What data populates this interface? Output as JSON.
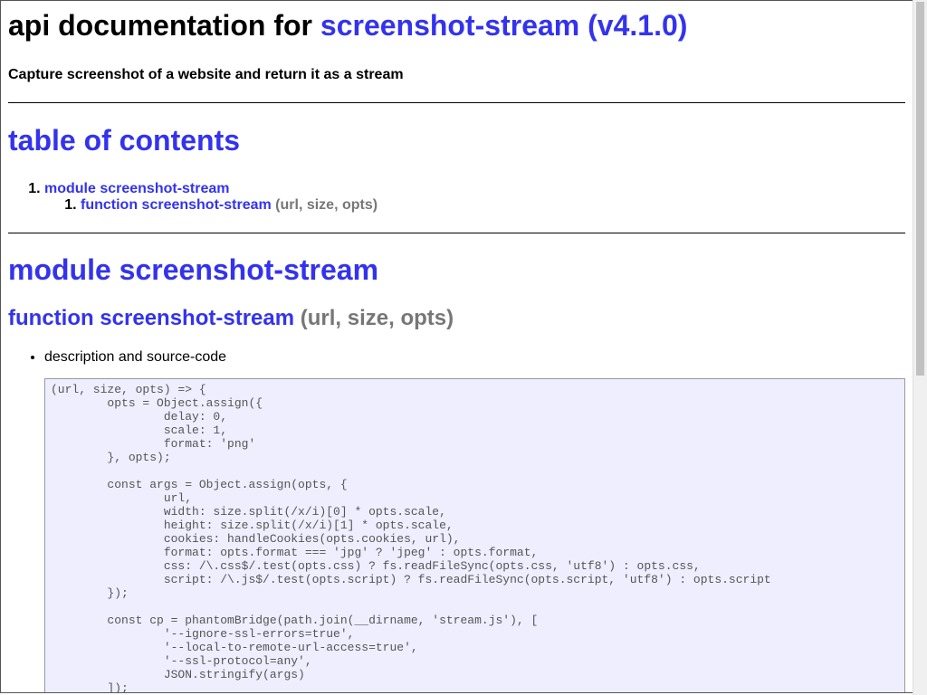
{
  "header": {
    "title_prefix": "api documentation for",
    "package_link": "screenshot-stream (v4.1.0)",
    "description": "Capture screenshot of a website and return it as a stream"
  },
  "toc": {
    "heading": "table of contents",
    "items": [
      {
        "number": "1.",
        "label": "module screenshot-stream",
        "children": [
          {
            "number": "1.",
            "label": "function screenshot-stream",
            "signature": "(url, size, opts)"
          }
        ]
      }
    ]
  },
  "module": {
    "heading": "module screenshot-stream",
    "function": {
      "name": "function screenshot-stream",
      "signature": "(url, size, opts)",
      "bullet": "description and source-code",
      "code": "(url, size, opts) => {\n\topts = Object.assign({\n\t\tdelay: 0,\n\t\tscale: 1,\n\t\tformat: 'png'\n\t}, opts);\n\n\tconst args = Object.assign(opts, {\n\t\turl,\n\t\twidth: size.split(/x/i)[0] * opts.scale,\n\t\theight: size.split(/x/i)[1] * opts.scale,\n\t\tcookies: handleCookies(opts.cookies, url),\n\t\tformat: opts.format === 'jpg' ? 'jpeg' : opts.format,\n\t\tcss: /\\.css$/.test(opts.css) ? fs.readFileSync(opts.css, 'utf8') : opts.css,\n\t\tscript: /\\.js$/.test(opts.script) ? fs.readFileSync(opts.script, 'utf8') : opts.script\n\t});\n\n\tconst cp = phantomBridge(path.join(__dirname, 'stream.js'), [\n\t\t'--ignore-ssl-errors=true',\n\t\t'--local-to-remote-url-access=true',\n\t\t'--ssl-protocol=any',\n\t\tJSON.stringify(args)\n\t]);"
    }
  }
}
